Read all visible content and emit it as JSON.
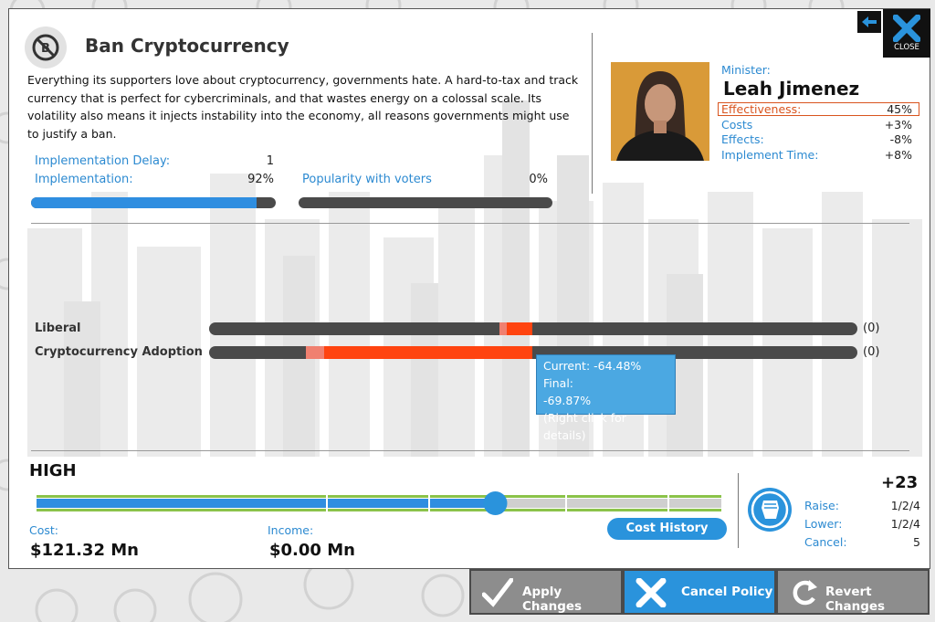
{
  "policy": {
    "title": "Ban Cryptocurrency",
    "description": "Everything its supporters love about cryptocurrency, governments hate. A hard-to-tax and track currency that is perfect for cybercriminals, and that wastes energy on a colossal scale. Its volatility also means it injects instability into the economy, all reasons governments might use to justify a ban.",
    "icon": "no-bitcoin-icon"
  },
  "stats": {
    "delay_label": "Implementation Delay:",
    "delay_value": "1",
    "impl_label": "Implementation:",
    "impl_value": "92%",
    "impl_fraction": 0.92,
    "popularity_label": "Popularity with voters",
    "popularity_value": "0%",
    "popularity_fraction": 0
  },
  "minister": {
    "label": "Minister:",
    "name": "Leah Jimenez",
    "effectiveness_label": "Effectiveness:",
    "effectiveness_value": "45%",
    "costs_label": "Costs",
    "costs_value": "+3%",
    "effects_label": "Effects:",
    "effects_value": "-8%",
    "impl_time_label": "Implement Time:",
    "impl_time_value": "+8%"
  },
  "effects": [
    {
      "label": "Liberal",
      "count": "(0)"
    },
    {
      "label": "Cryptocurrency Adoption",
      "count": "(0)"
    }
  ],
  "tooltip": {
    "line1": "Current: -64.48% Final:",
    "line2": "-69.87%",
    "line3": "(Right click for details)"
  },
  "slider": {
    "level_label": "HIGH",
    "position_fraction": 0.67
  },
  "finance": {
    "cost_label": "Cost:",
    "cost_value": "$121.32 Mn",
    "income_label": "Income:",
    "income_value": "$0.00 Mn",
    "cost_history_label": "Cost History"
  },
  "capital": {
    "total": "+23",
    "raise_label": "Raise:",
    "raise_value": "1/2/4",
    "lower_label": "Lower:",
    "lower_value": "1/2/4",
    "cancel_label": "Cancel:",
    "cancel_value": "5",
    "icon": "raised-fist-icon"
  },
  "buttons": {
    "apply": "Apply Changes",
    "cancel": "Cancel Policy",
    "revert": "Revert Changes",
    "close": "CLOSE"
  },
  "colors": {
    "accent": "#2c8ad1",
    "effect_negative": "#ff4410",
    "effectiveness_border": "#d9541e",
    "slider_green": "#8bc34a",
    "bottom_button_gray": "#8d8d8d",
    "bottom_button_blue": "#2a93dc"
  }
}
